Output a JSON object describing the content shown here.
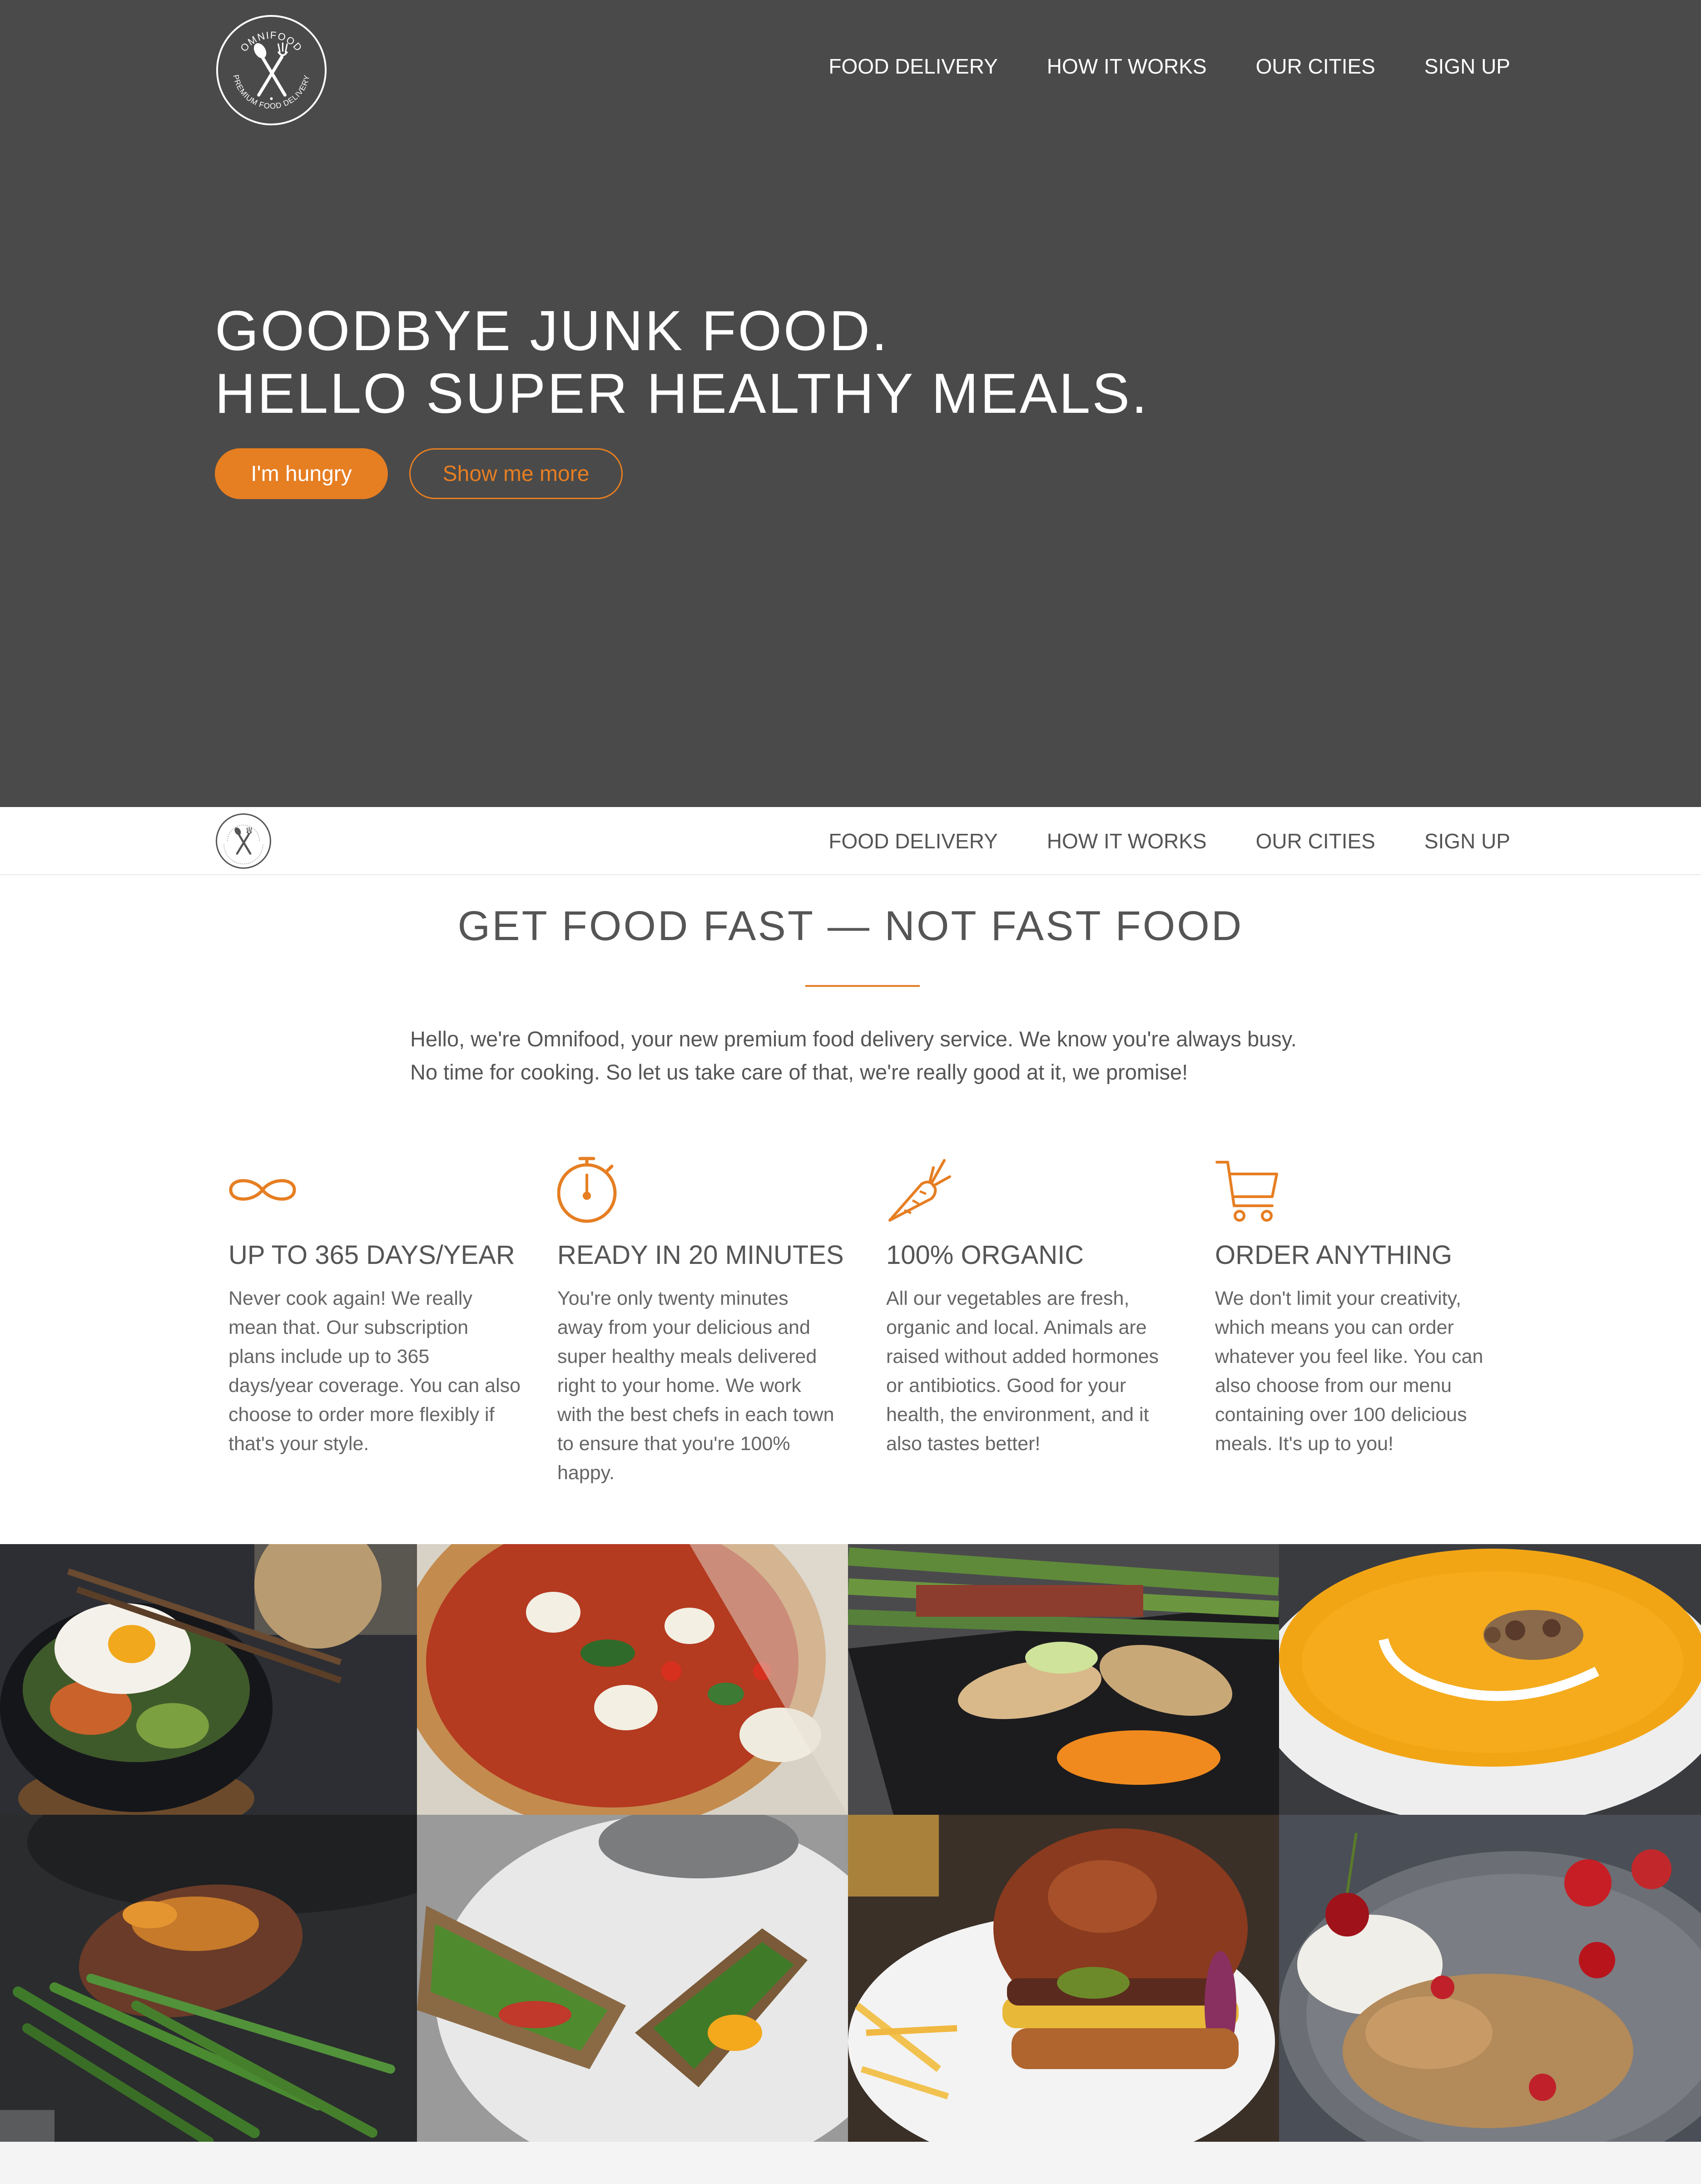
{
  "brand": {
    "logo_top": "OMNIFOOD",
    "logo_bottom": "PREMIUM FOOD DELIVERY"
  },
  "nav": {
    "items": [
      {
        "label": "FOOD DELIVERY"
      },
      {
        "label": "HOW IT WORKS"
      },
      {
        "label": "OUR CITIES"
      },
      {
        "label": "SIGN UP"
      }
    ]
  },
  "hero": {
    "line1": "GOODBYE JUNK FOOD.",
    "line2": "HELLO SUPER HEALTHY MEALS.",
    "primary_button": "I'm hungry",
    "secondary_button": "Show me more"
  },
  "features": {
    "title": "GET FOOD FAST — NOT FAST FOOD",
    "intro_line1": "Hello, we're Omnifood, your new premium food delivery service. We know you're always busy.",
    "intro_line2": "No time for cooking. So let us take care of that, we're really good at it, we promise!",
    "items": [
      {
        "icon": "infinity-icon",
        "title": "UP TO 365 DAYS/YEAR",
        "lines": [
          "Never cook again! We really",
          "mean that. Our subscription",
          "plans include up to 365",
          "days/year coverage. You can also",
          "choose to order more flexibly if",
          "that's your style."
        ]
      },
      {
        "icon": "stopwatch-icon",
        "title": "READY IN 20 MINUTES",
        "lines": [
          "You're only twenty minutes",
          "away from your delicious and",
          "super healthy meals delivered",
          "right to your home. We work",
          "with the best chefs in each town",
          "to ensure that you're 100%",
          "happy."
        ]
      },
      {
        "icon": "carrot-icon",
        "title": "100% ORGANIC",
        "lines": [
          "All our vegetables are fresh,",
          "organic and local. Animals are",
          "raised without added hormones",
          "or antibiotics. Good for your",
          "health, the environment, and it",
          "also tastes better!"
        ]
      },
      {
        "icon": "cart-icon",
        "title": "ORDER ANYTHING",
        "lines": [
          "We don't limit your creativity,",
          "which means you can order",
          "whatever you feel like. You can",
          "also choose from our menu",
          "containing over 100 delicious",
          "meals. It's up to you!"
        ]
      }
    ]
  },
  "colors": {
    "accent": "#e67e22",
    "hero_bg": "#4a4a4a",
    "text": "#555555"
  },
  "meals": [
    {
      "name": "bibimbap-photo"
    },
    {
      "name": "pizza-photo"
    },
    {
      "name": "chicken-asparagus-photo"
    },
    {
      "name": "pumpkin-soup-photo"
    },
    {
      "name": "steak-greenbeans-photo"
    },
    {
      "name": "sandwich-photo"
    },
    {
      "name": "burger-fries-photo"
    },
    {
      "name": "granola-cherries-photo"
    }
  ]
}
